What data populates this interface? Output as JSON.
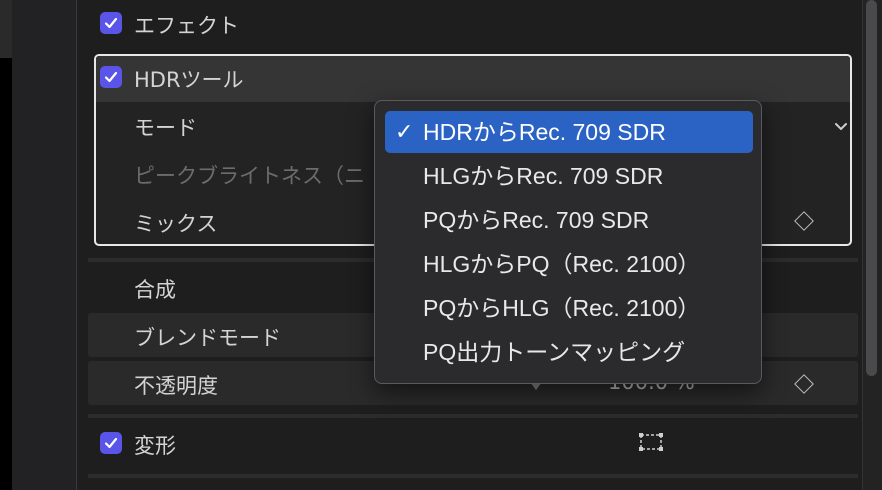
{
  "sections": {
    "effects": {
      "label": "エフェクト",
      "checked": true
    },
    "hdr_tools": {
      "label": "HDRツール",
      "checked": true,
      "params": {
        "mode": "モード",
        "peak_brightness": "ピークブライトネス（ニ",
        "mix": "ミックス"
      }
    },
    "compositing": {
      "label": "合成",
      "params": {
        "blend_mode": "ブレンドモード",
        "opacity": "不透明度",
        "opacity_value": "100.0 %"
      }
    },
    "transform": {
      "label": "変形",
      "checked": true
    }
  },
  "dropdown": {
    "check_glyph": "✓",
    "items": [
      {
        "label": "HDRからRec. 709 SDR",
        "selected": true
      },
      {
        "label": "HLGからRec. 709 SDR",
        "selected": false
      },
      {
        "label": "PQからRec. 709 SDR",
        "selected": false
      },
      {
        "label": "HLGからPQ（Rec. 2100）",
        "selected": false
      },
      {
        "label": "PQからHLG（Rec. 2100）",
        "selected": false
      },
      {
        "label": "PQ出力トーンマッピング",
        "selected": false
      }
    ]
  },
  "colors": {
    "checkbox": "#5a55e8",
    "selection": "#2b63c4"
  }
}
